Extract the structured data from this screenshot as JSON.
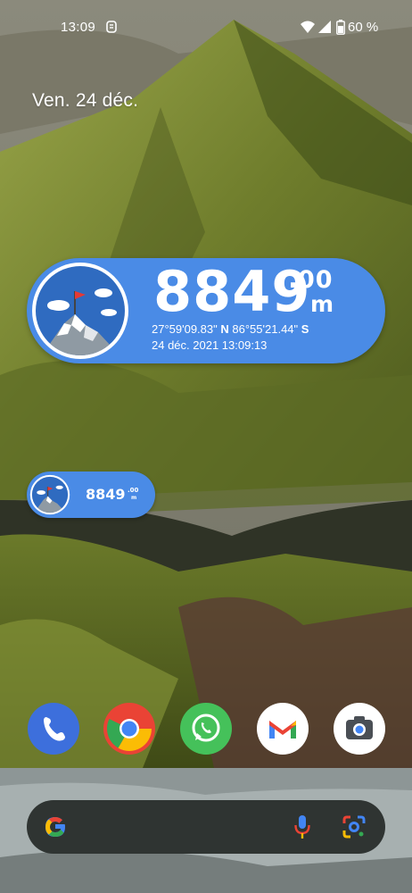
{
  "status_bar": {
    "time": "13:09",
    "battery_percent": "60 %",
    "icons": [
      "app-notification-icon",
      "wifi-icon",
      "cell-signal-icon",
      "battery-icon"
    ]
  },
  "home": {
    "date": "Ven. 24 déc."
  },
  "widget_large": {
    "altitude_integer": "8849",
    "altitude_separator": ".",
    "altitude_decimals": "00",
    "unit": "m",
    "latitude": "27°59'09.83\"",
    "lat_dir": "N",
    "longitude": "86°55'21.44\"",
    "lon_dir": "S",
    "datetime": "24 déc. 2021 13:09:13",
    "icon": "mountain-summit-flag-icon",
    "color": "#4a8be6"
  },
  "widget_small": {
    "altitude_integer": "8849",
    "altitude_decimals": ".00",
    "unit": "m",
    "icon": "mountain-summit-flag-icon",
    "color": "#4a8be6"
  },
  "dock": {
    "apps": [
      {
        "name": "Phone",
        "icon": "phone-icon",
        "color": "#3c6fe0"
      },
      {
        "name": "Chrome",
        "icon": "chrome-icon",
        "color": "#ea4335"
      },
      {
        "name": "WhatsApp",
        "icon": "whatsapp-icon",
        "color": "#45c15a"
      },
      {
        "name": "Gmail",
        "icon": "gmail-icon",
        "color": "#ffffff"
      },
      {
        "name": "Camera",
        "icon": "camera-icon",
        "color": "#ffffff"
      }
    ]
  },
  "search": {
    "icons": [
      "google-g-icon",
      "mic-icon",
      "lens-icon"
    ]
  }
}
